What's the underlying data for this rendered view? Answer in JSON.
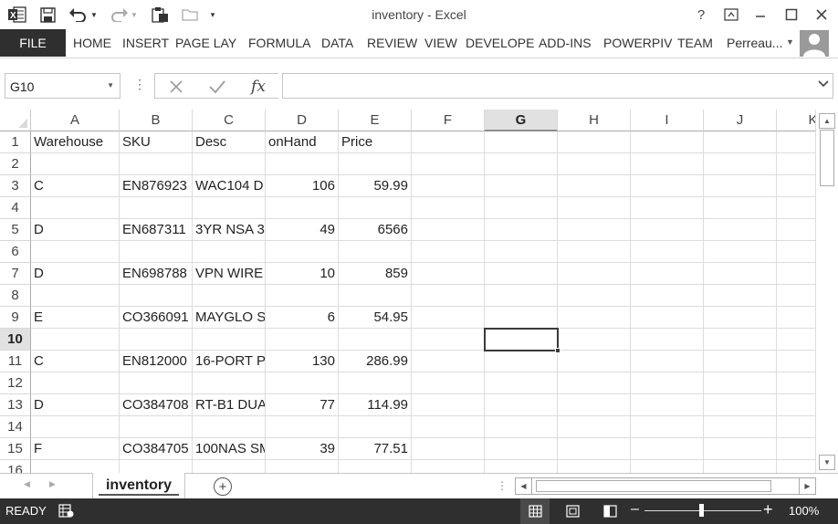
{
  "window": {
    "title": "inventory - Excel",
    "help_label": "?",
    "file_tab": "FILE",
    "tabs": [
      "HOME",
      "INSERT",
      "PAGE LAY",
      "FORMULA",
      "DATA",
      "REVIEW",
      "VIEW",
      "DEVELOPE",
      "ADD-INS",
      "POWERPIV",
      "TEAM"
    ],
    "user_name": "Perreau..."
  },
  "formula_bar": {
    "name_box": "G10",
    "fx_label": "fx",
    "formula": ""
  },
  "sheet": {
    "columns": [
      "A",
      "B",
      "C",
      "D",
      "E",
      "F",
      "G",
      "H",
      "I",
      "J",
      "K"
    ],
    "active_column": "G",
    "active_row": 10,
    "rows": [
      {
        "n": "1",
        "cells": [
          "Warehouse",
          "SKU",
          "Desc",
          "onHand",
          "Price"
        ]
      },
      {
        "n": "2",
        "cells": [
          "",
          "",
          "",
          "",
          ""
        ]
      },
      {
        "n": "3",
        "cells": [
          "C",
          "EN876923",
          "WAC104 D",
          "106",
          "59.99"
        ]
      },
      {
        "n": "4",
        "cells": [
          "",
          "",
          "",
          "",
          ""
        ]
      },
      {
        "n": "5",
        "cells": [
          "D",
          "EN687311",
          "3YR NSA 3",
          "49",
          "6566"
        ]
      },
      {
        "n": "6",
        "cells": [
          "",
          "",
          "",
          "",
          ""
        ]
      },
      {
        "n": "7",
        "cells": [
          "D",
          "EN698788",
          "VPN WIRE",
          "10",
          "859"
        ]
      },
      {
        "n": "8",
        "cells": [
          "",
          "",
          "",
          "",
          ""
        ]
      },
      {
        "n": "9",
        "cells": [
          "E",
          "CO366091",
          "MAYGLO S",
          "6",
          "54.95"
        ]
      },
      {
        "n": "10",
        "cells": [
          "",
          "",
          "",
          "",
          ""
        ]
      },
      {
        "n": "11",
        "cells": [
          "C",
          "EN812000",
          "16-PORT P",
          "130",
          "286.99"
        ]
      },
      {
        "n": "12",
        "cells": [
          "",
          "",
          "",
          "",
          ""
        ]
      },
      {
        "n": "13",
        "cells": [
          "D",
          "CO384708",
          "RT-B1 DUA",
          "77",
          "114.99"
        ]
      },
      {
        "n": "14",
        "cells": [
          "",
          "",
          "",
          "",
          ""
        ]
      },
      {
        "n": "15",
        "cells": [
          "F",
          "CO384705",
          "100NAS SM",
          "39",
          "77.51"
        ]
      },
      {
        "n": "16",
        "cells": [
          "",
          "",
          "",
          "",
          ""
        ]
      }
    ]
  },
  "sheet_tabs": {
    "active": "inventory"
  },
  "status": {
    "text": "READY",
    "zoom": "100%"
  }
}
